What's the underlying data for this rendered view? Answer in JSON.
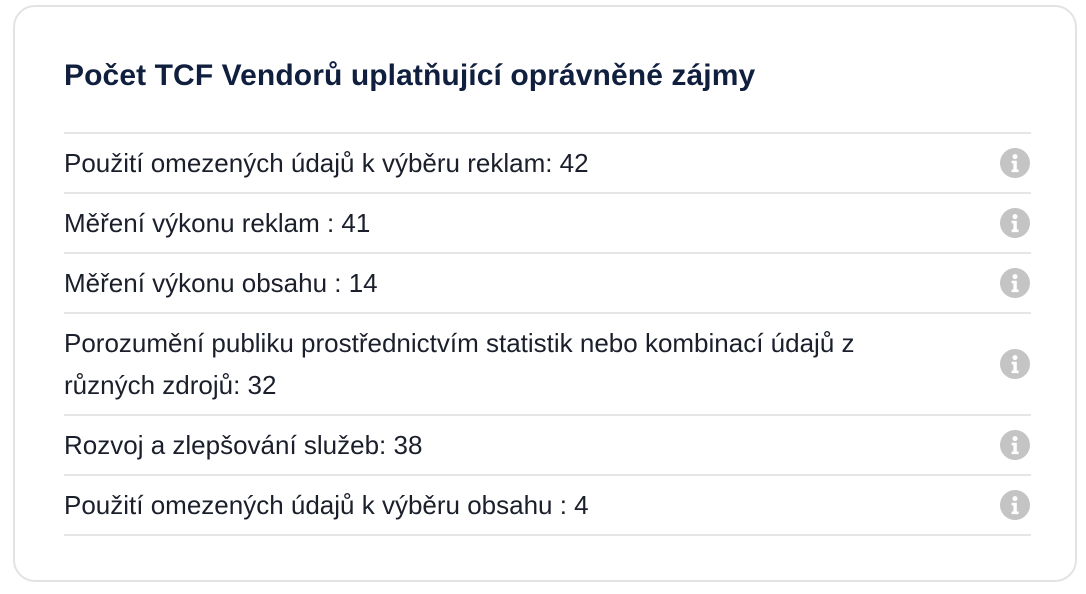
{
  "title": "Počet TCF Vendorů uplatňující oprávněné zájmy",
  "items": [
    {
      "label": "Použití omezených údajů k výběru reklam: 42",
      "icon": "info-icon"
    },
    {
      "label": "Měření výkonu reklam : 41",
      "icon": "info-icon"
    },
    {
      "label": "Měření výkonu obsahu : 14",
      "icon": "info-icon"
    },
    {
      "label": "Porozumění publiku prostřednictvím statistik nebo kombinací údajů z různých zdrojů: 32",
      "icon": "info-icon"
    },
    {
      "label": "Rozvoj a zlepšování služeb: 38",
      "icon": "info-icon"
    },
    {
      "label": "Použití omezených údajů k výběru obsahu : 4",
      "icon": "info-icon"
    }
  ],
  "colors": {
    "title": "#0f1f3d",
    "text": "#1a1f2b",
    "divider": "#e6e6e6",
    "icon_bg": "#c4c4c4",
    "card_border": "#e3e3e3"
  }
}
